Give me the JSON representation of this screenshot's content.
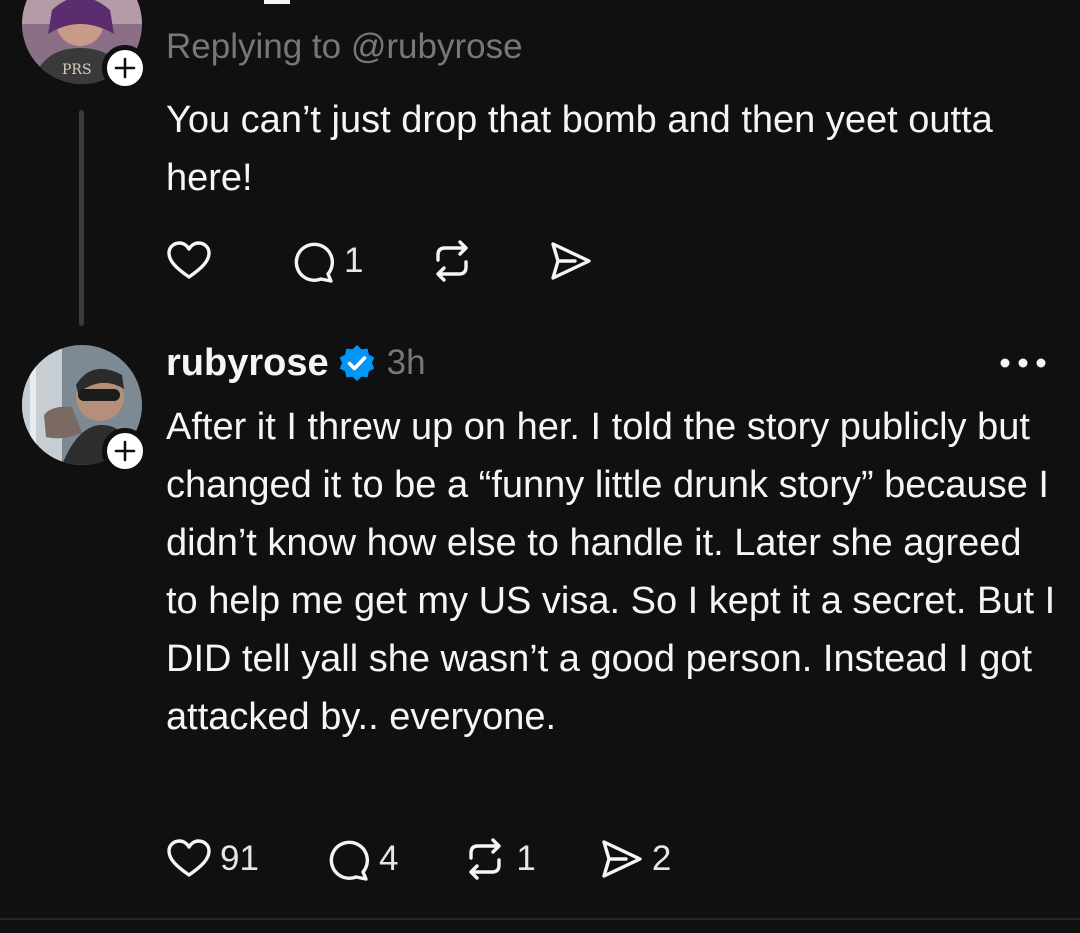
{
  "colors": {
    "background": "#101010",
    "text_primary": "#f3f5f7",
    "text_secondary": "#777777",
    "verified_blue": "#0095f6",
    "thread_line": "#3b3b3b"
  },
  "reply_post": {
    "avatar": "user-avatar-photo",
    "follow_badge_icon": "plus-icon",
    "replying_to": "Replying to @rubyrose",
    "text": "You can’t just drop that bomb and then yeet outta here!",
    "actions": {
      "like": {
        "icon": "heart-icon",
        "count": ""
      },
      "comment": {
        "icon": "comment-icon",
        "count": "1"
      },
      "repost": {
        "icon": "repost-icon",
        "count": ""
      },
      "share": {
        "icon": "send-icon",
        "count": ""
      }
    }
  },
  "main_post": {
    "avatar": "rubyrose-avatar-photo",
    "follow_badge_icon": "plus-icon",
    "username": "rubyrose",
    "verified_icon": "verified-badge-icon",
    "timestamp": "3h",
    "more_icon": "more-dots-icon",
    "text": "After it I threw up on her. I told the story publicly but changed it to be a “funny little drunk story” because I didn’t know how else to handle it. Later she agreed to help me get my US visa. So I kept it a secret. But I DID tell yall she wasn’t a good person. Instead I got attacked by.. everyone.",
    "actions": {
      "like": {
        "icon": "heart-icon",
        "count": "91"
      },
      "comment": {
        "icon": "comment-icon",
        "count": "4"
      },
      "repost": {
        "icon": "repost-icon",
        "count": "1"
      },
      "share": {
        "icon": "send-icon",
        "count": "2"
      }
    }
  }
}
